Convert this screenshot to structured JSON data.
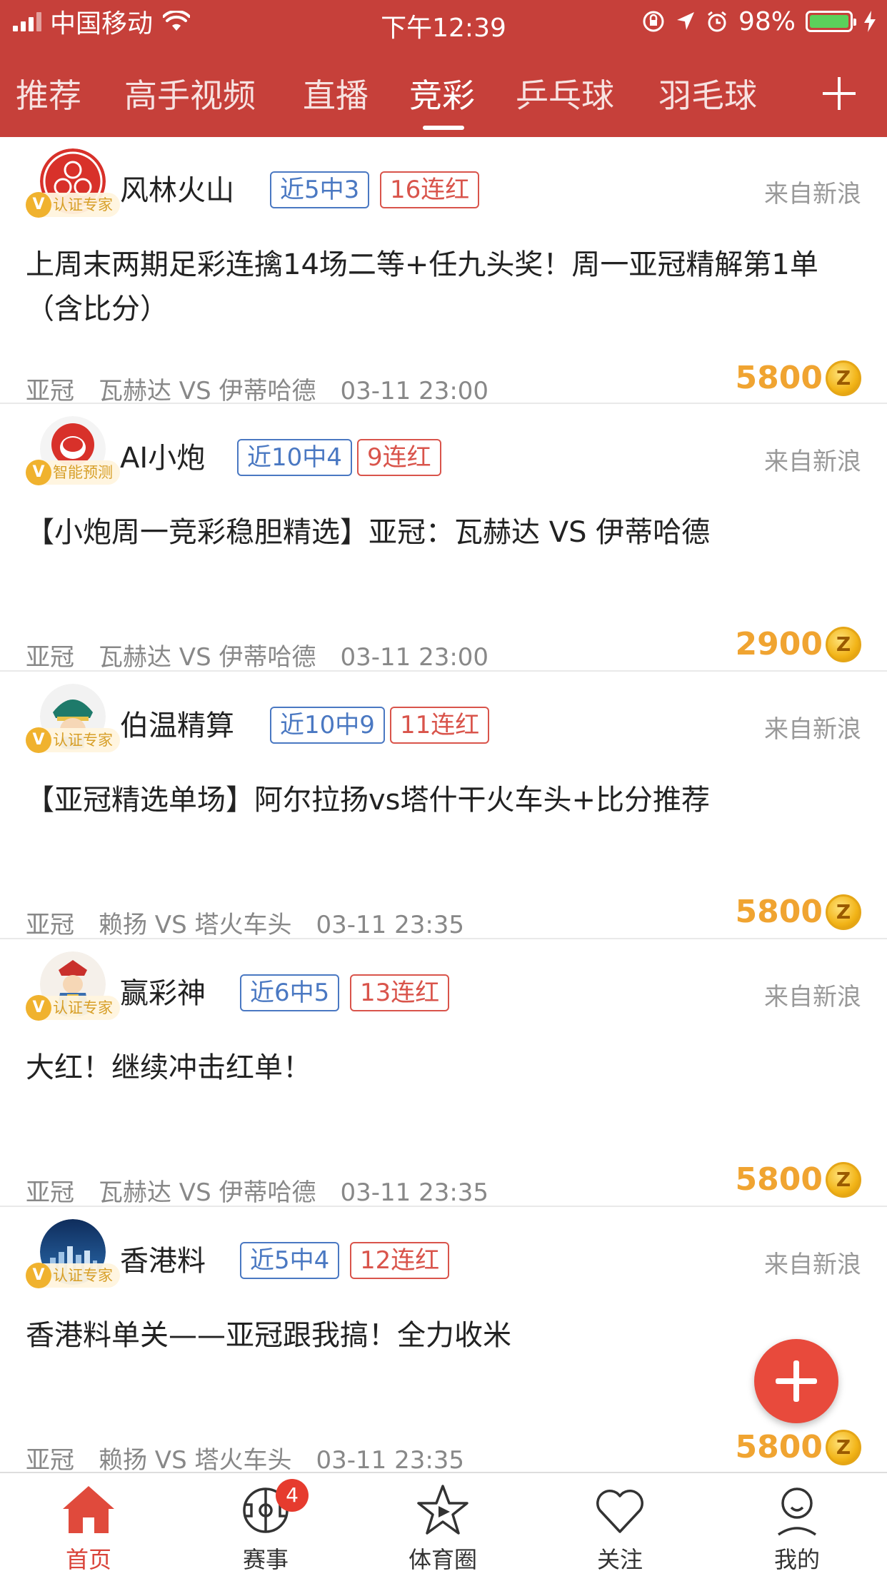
{
  "status_bar": {
    "carrier": "中国移动",
    "time": "下午12:39",
    "battery": "98%"
  },
  "tabs": [
    {
      "label": "推荐"
    },
    {
      "label": "高手视频"
    },
    {
      "label": "直播"
    },
    {
      "label": "竞彩"
    },
    {
      "label": "乒乓球"
    },
    {
      "label": "羽毛球"
    }
  ],
  "active_tab": "竞彩",
  "colors": {
    "header": "#c6403a",
    "blue_tag": "#4a78c2",
    "red_tag": "#d9544b",
    "price": "#f0a431",
    "fab": "#e84a3c"
  },
  "cards": [
    {
      "author": "风林火山",
      "badge": "认证专家",
      "badge_v": "V",
      "record": "近5中3",
      "streak": "16连红",
      "source": "来自新浪",
      "title": "上周末两期足彩连擒14场二等+任九头奖！周一亚冠精解第1单（含比分）",
      "league": "亚冠",
      "match": "瓦赫达 VS 伊蒂哈德",
      "time": "03-11 23:00",
      "price": "5800",
      "coin": "Z"
    },
    {
      "author": "AI小炮",
      "badge": "智能预测",
      "badge_v": "V",
      "record": "近10中4",
      "streak": "9连红",
      "source": "来自新浪",
      "title": "【小炮周一竞彩稳胆精选】亚冠：瓦赫达 VS 伊蒂哈德",
      "league": "亚冠",
      "match": "瓦赫达 VS 伊蒂哈德",
      "time": "03-11 23:00",
      "price": "2900",
      "coin": "Z"
    },
    {
      "author": "伯温精算",
      "badge": "认证专家",
      "badge_v": "V",
      "record": "近10中9",
      "streak": "11连红",
      "source": "来自新浪",
      "title": "【亚冠精选单场】阿尔拉扬vs塔什干火车头+比分推荐",
      "league": "亚冠",
      "match": "赖扬 VS 塔火车头",
      "time": "03-11 23:35",
      "price": "5800",
      "coin": "Z"
    },
    {
      "author": "赢彩神",
      "badge": "认证专家",
      "badge_v": "V",
      "record": "近6中5",
      "streak": "13连红",
      "source": "来自新浪",
      "title": "大红！继续冲击红单！",
      "league": "亚冠",
      "match": "瓦赫达 VS 伊蒂哈德",
      "time": "03-11 23:35",
      "price": "5800",
      "coin": "Z"
    },
    {
      "author": "香港料",
      "badge": "认证专家",
      "badge_v": "V",
      "record": "近5中4",
      "streak": "12连红",
      "source": "来自新浪",
      "title": "香港料单关——亚冠跟我搞！全力收米",
      "league": "亚冠",
      "match": "赖扬 VS 塔火车头",
      "time": "03-11 23:35",
      "price": "5800",
      "coin": "Z"
    }
  ],
  "bottom_nav": {
    "items": [
      {
        "label": "首页",
        "icon": "home-icon"
      },
      {
        "label": "赛事",
        "icon": "pitch-icon",
        "badge": "4"
      },
      {
        "label": "体育圈",
        "icon": "star-play-icon"
      },
      {
        "label": "关注",
        "icon": "heart-icon"
      },
      {
        "label": "我的",
        "icon": "person-icon"
      }
    ]
  }
}
